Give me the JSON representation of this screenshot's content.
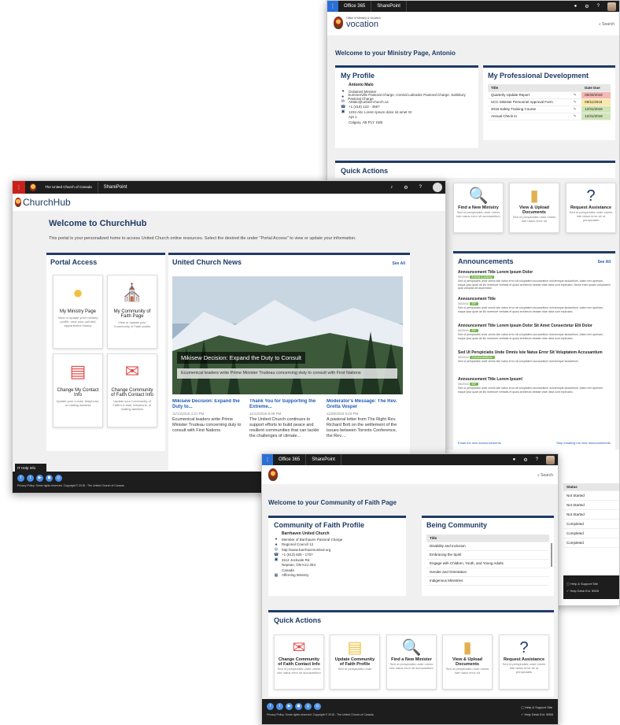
{
  "ministry": {
    "bar": {
      "app": "Office 365",
      "site": "SharePoint"
    },
    "logo_small": "Office of Ministry & Vocation",
    "logo_word": "vocation",
    "search": "Search",
    "welcome": "Welcome to your Ministry Page, Antonio",
    "profile": {
      "title": "My Profile",
      "name": "Antonio Malo",
      "rows": [
        {
          "icon": "tag-icon",
          "glyph": "♦",
          "text": "Ordained Minister"
        },
        {
          "icon": "location-icon",
          "glyph": "●",
          "text": "Summerville Pastoral Charge, Central Labrador Pastoral Charge, Salisbury Pastoral Charge"
        },
        {
          "icon": "email-icon",
          "glyph": "✉",
          "text": "AMalo@united-church.ca"
        },
        {
          "icon": "phone-icon",
          "glyph": "☎",
          "text": "+1 (416) 123 - 4567"
        },
        {
          "icon": "address-icon",
          "glyph": "▣",
          "text": "1234 Abc Lorem Ipsum dolor sit amet St"
        },
        {
          "icon": "",
          "glyph": "",
          "text": "Apt 1"
        },
        {
          "icon": "",
          "glyph": "",
          "text": "Calgary, AB P1Y 1M5"
        }
      ]
    },
    "development": {
      "title": "My Professional Development",
      "headers": [
        "Title",
        "Date Due"
      ],
      "rows": [
        {
          "title": "Quarterly Update Report",
          "date": "08/30/2018",
          "color": "#f4b9b5"
        },
        {
          "title": "UCC Minister Personnel Approval Form",
          "date": "09/11/2018",
          "color": "#fbe8a6"
        },
        {
          "title": "2018 Safety Training Course",
          "date": "12/31/2018",
          "color": "#cfe5b5"
        },
        {
          "title": "Annual Check In",
          "date": "12/31/2018",
          "color": "#cfe5b5"
        }
      ]
    },
    "quick_title": "Quick Actions",
    "tiles": [
      {
        "title": "Find a New Ministry",
        "desc": "Sed ut perspiciatis unde omnis iste natus error sit accusantium",
        "glyph": "🔍",
        "color": "#6aa84f"
      },
      {
        "title": "View & Upload Documents",
        "desc": "Sed ut perspiciatis unde omnis iste natus error sit",
        "glyph": "▮",
        "color": "#e0b050"
      },
      {
        "title": "Request Assistance",
        "desc": "Sed ut perspiciatis unde omnis iste natus error sit ut perspiciatis",
        "glyph": "?",
        "color": "#1f3b66"
      }
    ],
    "announcements": {
      "title": "Announcements",
      "see_all": "See All",
      "items": [
        {
          "title": "Announcement Title Lorem Ipsum Dolor",
          "date": "06/20/18",
          "tag": "Events & Activity",
          "body": "Sed ut perspiciatis unde omnis iste natus error sit voluptatem accusantium doloremque laudantium, totam rem aperiam, eaque ipsa quae ab illo inventore veritatis et quasi architecto beatae vitae dicta sunt explicabo. Nemo enim ipsam voluptatem quia voluptas sit aspernatur."
        },
        {
          "title": "Announcement Title",
          "date": "06/20/18",
          "tag": "EIF",
          "body": "Sed ut perspiciatis unde omnis iste natus error sit voluptatem accusantium doloremque laudantium, totam rem aperiam, eaque ipsa quae ab illo inventore veritatis et quasi architecto beatae vitae dicta sunt explicabo."
        },
        {
          "title": "Announcement Title Lorem Ipsum Dolor Sit Amet Consectetur Elit Dolor",
          "date": "06/20/18",
          "tag": "EIF",
          "body": "Sed ut perspiciatis unde omnis iste natus error sit voluptatem accusantium doloremque laudantium, totam rem aperiam, eaque ipsa quae ab illo inventore veritatis et quasi architecto beatae vitae dicta sunt explicabo."
        },
        {
          "title": "Sed Ut Perspiciatis Unde Omnis Iste Natus Error Sit Voluptatem Accusantium",
          "date": "06/20/18",
          "tag": "Communications",
          "body": "Sed ut perspiciatis unde omnis iste natus error sit voluptatem accusantium doloremque laudantium."
        },
        {
          "title": "Announcement Title Lorem Ipsum!",
          "date": "06/20/18",
          "tag": "EIF",
          "body": "Sed ut perspiciatis unde omnis iste natus error sit voluptatem accusantium doloremque laudantium, totam rem aperiam, eaque ipsa quae ab illo inventore veritatis et quasi architecto beatae vitae dicta sunt explicabo."
        }
      ],
      "email_me": "Email me new announcements",
      "stop_email": "Stop emailing me new announcements"
    },
    "status": {
      "header": "Status",
      "rows": [
        "Not Started",
        "Not Started",
        "Not Started",
        "Completed",
        "Completed",
        "Completed"
      ],
      "help_site": "Help & Support Site",
      "help_desk": "Help Desk Ext. 5555"
    }
  },
  "churchhub": {
    "bar": {
      "org": "The United Church of Canada",
      "site": "SharePoint"
    },
    "logo": "ChurchHub",
    "welcome": "Welcome to ChurchHub",
    "intro": "This portal is your personalized home to access United Church online resources. Select the desired tile under \"Portal Access\" to view or update your information.",
    "portal": {
      "title": "Portal Access",
      "tiles": [
        {
          "title": "My Ministry Page",
          "desc": "View or update your ministry profile, view your call and appointment history",
          "glyph": "●",
          "color": "#f0c040"
        },
        {
          "title": "My Community of Faith Page",
          "desc": "View or update your Community of Faith profile",
          "glyph": "⛪",
          "color": "#6aa84f"
        },
        {
          "title": "Change My Contact Info",
          "desc": "Update your e-mail, telephone, or mailing address",
          "glyph": "▤",
          "color": "#e05050"
        },
        {
          "title": "Change Community of Faith Contact Info",
          "desc": "Update your Community of Faith's e-mail, telephone, or mailing address",
          "glyph": "✉",
          "color": "#e05050"
        }
      ]
    },
    "news": {
      "title": "United Church News",
      "see_all": "See All",
      "headline": "Mikisew Decision: Expand the Duty to Consult",
      "summary": "Ecumenical leaders write Prime Minister Trudeau concerning duty to consult with First Nations",
      "items": [
        {
          "title": "Mikisew Decision: Expand the Duty to...",
          "date": "11/14/2018 3:21 PM",
          "body": "Ecumenical leaders write Prime Minister Trudeau concerning duty to consult with First Nations"
        },
        {
          "title": "Thank You for Supporting the Extreme...",
          "date": "11/12/2018 8:09 PM",
          "body": "The United Church continues to support efforts to build peace and resilient communities that can tackle the challenges of climate..."
        },
        {
          "title": "Moderator's Message: The Rev. Gretta Vosper",
          "date": "11/09/2018 5:03 PM",
          "body": "A pastoral letter from The Right Rev. Richard Bott on the settlement of the issues between Toronto Conference, the Rev...."
        }
      ]
    },
    "it_help": "IT Help Info",
    "footer": "Privacy Policy. Some rights reserved. Copyright © 2018 - The United Church of Canada"
  },
  "community": {
    "bar": {
      "app": "Office 365",
      "site": "SharePoint"
    },
    "search": "Search",
    "welcome": "Welcome to your Community of Faith Page",
    "profile": {
      "title": "Community of Faith Profile",
      "name": "Barrhaven United Church",
      "rows": [
        {
          "icon": "tag-icon",
          "glyph": "♦",
          "text": "Member of Barrhaven Pastoral Charge"
        },
        {
          "icon": "location-icon",
          "glyph": "●",
          "text": "Regional Council 12"
        },
        {
          "icon": "web-icon",
          "glyph": "◎",
          "text": "http://www.barrhavenunited.org"
        },
        {
          "icon": "phone-icon",
          "glyph": "☎",
          "text": "+1 (613) 825 - 1707"
        },
        {
          "icon": "address-icon",
          "glyph": "▣",
          "text": "3112 Jockvale Rd"
        },
        {
          "icon": "",
          "glyph": "",
          "text": "Nepean, ON K2J 4E4"
        },
        {
          "icon": "",
          "glyph": "",
          "text": "Canada"
        },
        {
          "icon": "ministry-icon",
          "glyph": "▦",
          "text": "Affirming Ministry"
        }
      ]
    },
    "being": {
      "title": "Being Community",
      "header": "Title",
      "rows": [
        "Disability and Inclusion",
        "Embracing the Spirit",
        "Engage with Children, Youth, and Young Adults",
        "Gender and Orientation",
        "Indigenous Ministries"
      ]
    },
    "quick_title": "Quick Actions",
    "tiles": [
      {
        "title": "Change Community of Faith Contact Info",
        "desc": "Sed ut perspiciatis unde omnis iste natus error sit accusantium",
        "glyph": "✉",
        "color": "#e05050"
      },
      {
        "title": "Update Community of Faith Profile",
        "desc": "Sed ut perspiciatis unde",
        "glyph": "▤",
        "color": "#f0c040"
      },
      {
        "title": "Find a New Minister",
        "desc": "Sed ut perspiciatis unde omnis iste natus error sit accusantium",
        "glyph": "🔍",
        "color": "#6aa84f"
      },
      {
        "title": "View & Upload Documents",
        "desc": "Sed ut perspiciatis unde omnis iste natus error sit",
        "glyph": "▮",
        "color": "#e0b050"
      },
      {
        "title": "Request Assistance",
        "desc": "Sed ut perspiciatis unde omnis iste natus error sit ut perspiciatis",
        "glyph": "?",
        "color": "#1f3b66"
      }
    ],
    "footer": "Privacy Policy. Some rights reserved. Copyright © 2018 - The United Church of Canada",
    "help_site": "Help & Support Site",
    "help_desk": "Help Desk Ext. 5555"
  }
}
